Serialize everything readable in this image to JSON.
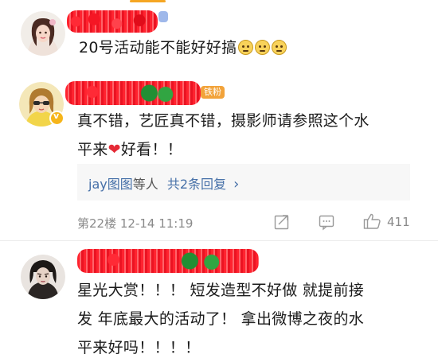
{
  "comments": [
    {
      "text": "20号活动能不能好好搞",
      "emoji_count": 3
    },
    {
      "badge": "铁粉",
      "line1_pre": "真不错，艺匠真不错，摄影师请参照这个水",
      "line2_pre": "平来",
      "line2_post": "好看！！",
      "heart": "❤",
      "reply": {
        "user": "jay图图",
        "mid": "等人",
        "more": "共2条回复",
        "chevron": "›"
      },
      "meta": "第22楼 12-14 11:19",
      "like_count": "411"
    },
    {
      "line1": "星光大赏！！！ 短发造型不好做 就提前接",
      "line2": "发 年底最大的活动了！ 拿出微博之夜的水",
      "line3": "平来好吗！！！！"
    }
  ],
  "colors": {
    "link": "#4670a8",
    "meta": "#8a8a8a",
    "heart": "#e52a36",
    "badge_orange": "#f2a33a"
  }
}
